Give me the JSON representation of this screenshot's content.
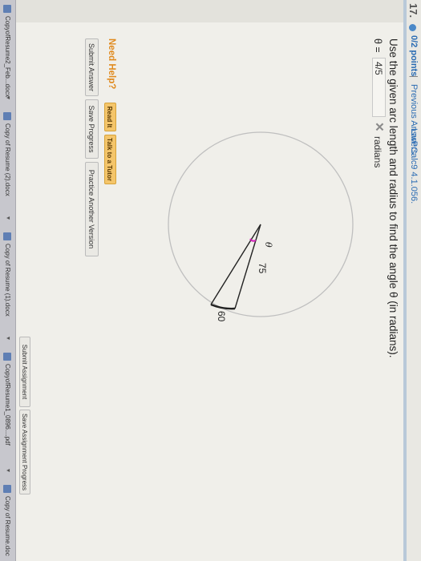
{
  "question": {
    "number": "17.",
    "points": "0/2 points",
    "separator": "|",
    "previous_answers": "Previous Answers",
    "reference": "LarPCalc9 4.1.056.",
    "prompt": "Use the given arc length and radius to find the angle θ (in radians).",
    "answer_label": "θ =",
    "answer_value": "4/5",
    "incorrect_mark": "✕",
    "units": "radians"
  },
  "figure": {
    "angle_label": "θ",
    "radius_label": "75",
    "arc_label": "60"
  },
  "help": {
    "title": "Need Help?",
    "read_it": "Read It",
    "talk": "Talk to a Tutor"
  },
  "actions": {
    "submit": "Submit Answer",
    "save": "Save Progress",
    "practice": "Practice Another Version"
  },
  "footer": {
    "submit_assignment": "Submit Assignment",
    "save_assignment": "Save Assignment Progress"
  },
  "downloads": [
    "CopyofResume2_Feb...docx",
    "Copy of Resume (2).docx",
    "Copy of Resume (1).docx",
    "CopyofResume1_0896....pdf",
    "Copy of Resume.doc"
  ],
  "colors": {
    "link": "#2b6cb3",
    "need_help": "#e08a1e",
    "angle_mark": "#d11fb8",
    "help_button": "#f4c56a"
  }
}
